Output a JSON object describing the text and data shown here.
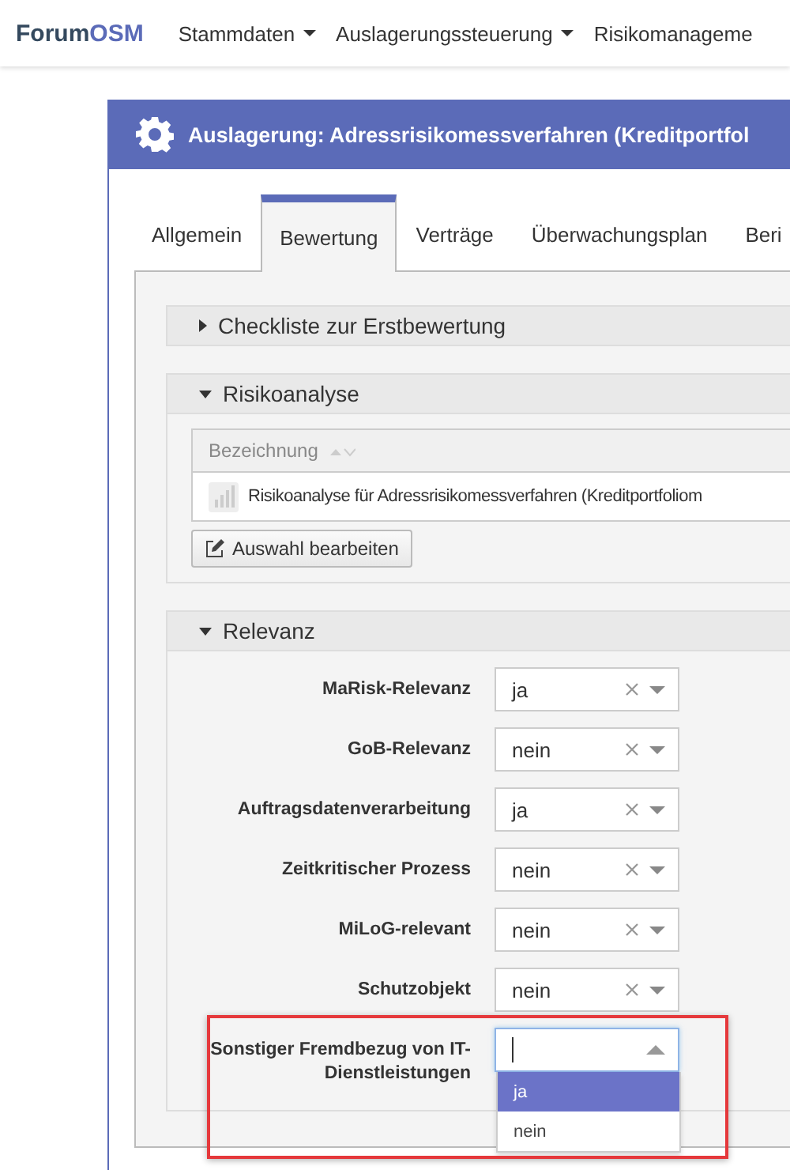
{
  "navbar": {
    "brand": "Forum",
    "brand_accent": "OSM",
    "menu": [
      {
        "label": "Stammdaten",
        "caret": true
      },
      {
        "label": "Auslagerungssteuerung",
        "caret": true
      },
      {
        "label": "Risikomanageme",
        "caret": false
      }
    ]
  },
  "dialog": {
    "title": "Auslagerung: Adressrisikomessverfahren (Kreditportfol",
    "tabs": [
      {
        "label": "Allgemein",
        "selected": false
      },
      {
        "label": "Bewertung",
        "selected": true
      },
      {
        "label": "Verträge",
        "selected": false
      },
      {
        "label": "Überwachungsplan",
        "selected": false
      },
      {
        "label": "Beri",
        "selected": false
      }
    ],
    "sections": [
      {
        "kind": "empty",
        "title": "Checkliste zur Erstbewertung",
        "expanded": false
      },
      {
        "kind": "table",
        "title": "Risikoanalyse",
        "expanded": true,
        "columns": [
          "Bezeichnung"
        ],
        "rows": [
          [
            "Risikoanalyse für Adressrisikomessverfahren (Kreditportfoliom"
          ]
        ],
        "button": "Auswahl bearbeiten"
      },
      {
        "kind": "form",
        "title": "Relevanz",
        "expanded": true,
        "fields": [
          {
            "label": "MaRisk-Relevanz",
            "value": "ja",
            "open": false
          },
          {
            "label": "GoB-Relevanz",
            "value": "nein",
            "open": false
          },
          {
            "label": "Auftragsdatenverarbeitung",
            "value": "ja",
            "open": false
          },
          {
            "label": "Zeitkritischer Prozess",
            "value": "nein",
            "open": false
          },
          {
            "label": "MiLoG-relevant",
            "value": "nein",
            "open": false
          },
          {
            "label": "Schutzobjekt",
            "value": "nein",
            "open": false
          },
          {
            "label": "Sonstiger Fremdbezug von IT-Dienstleistungen",
            "open": true,
            "highlighted": true,
            "options": [
              {
                "label": "ja",
                "selected": true
              },
              {
                "label": "nein",
                "selected": false
              }
            ]
          }
        ]
      }
    ]
  }
}
